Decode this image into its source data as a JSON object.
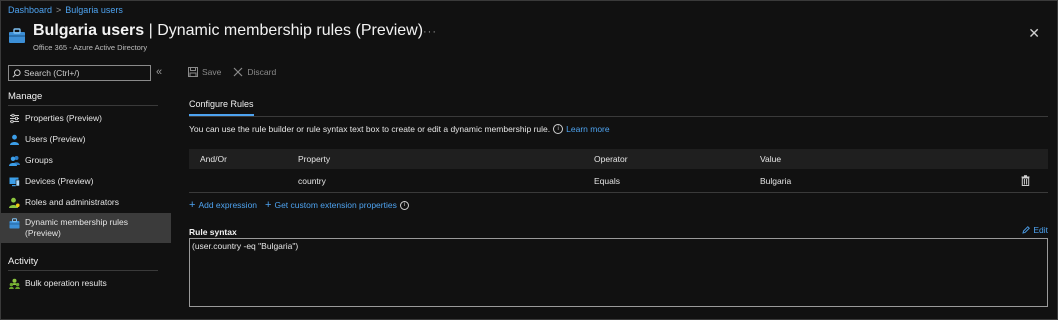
{
  "breadcrumb": {
    "items": [
      "Dashboard",
      "Bulgaria users"
    ],
    "separator": ">"
  },
  "header": {
    "title_bold": "Bulgaria users",
    "title_rest": " | Dynamic membership rules (Preview)",
    "subtitle": "Office 365 - Azure Active Directory",
    "more": "···",
    "close": "✕"
  },
  "sidebar": {
    "search_placeholder": "Search (Ctrl+/)",
    "collapse": "«",
    "manage_title": "Manage",
    "items": [
      {
        "label": "Properties (Preview)",
        "icon": "properties-icon"
      },
      {
        "label": "Users (Preview)",
        "icon": "user-icon"
      },
      {
        "label": "Groups",
        "icon": "groups-icon"
      },
      {
        "label": "Devices (Preview)",
        "icon": "devices-icon"
      },
      {
        "label": "Roles and administrators",
        "icon": "roles-icon"
      },
      {
        "label": "Dynamic membership rules",
        "label2": "(Preview)",
        "icon": "dynamic-rules-icon",
        "active": true
      }
    ],
    "activity_title": "Activity",
    "activity_items": [
      {
        "label": "Bulk operation results",
        "icon": "bulk-operations-icon"
      }
    ]
  },
  "toolbar": {
    "save": "Save",
    "discard": "Discard"
  },
  "tab": {
    "label": "Configure Rules"
  },
  "description": {
    "text": "You can use the rule builder or rule syntax text box to create or edit a dynamic membership rule.",
    "info": "i",
    "learn_more": "Learn more"
  },
  "grid": {
    "headers": [
      "And/Or",
      "Property",
      "Operator",
      "Value"
    ],
    "rows": [
      {
        "and_or": "",
        "property": "country",
        "operator": "Equals",
        "value": "Bulgaria"
      }
    ]
  },
  "actions": {
    "add_expression": "Add expression",
    "get_custom": "Get custom extension properties",
    "info": "i"
  },
  "rule_syntax": {
    "label": "Rule syntax",
    "edit": "Edit",
    "value": "(user.country -eq \"Bulgaria\")"
  },
  "colors": {
    "accent": "#4ea3f0",
    "background": "#111111",
    "active_nav": "#3b3b3b"
  }
}
